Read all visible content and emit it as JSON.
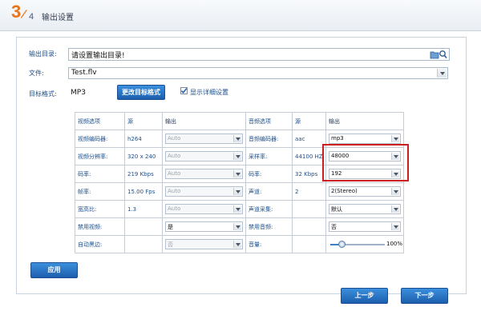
{
  "header": {
    "step_current": "3",
    "step_total": "4",
    "title": "输出设置"
  },
  "form": {
    "output_dir_label": "输出目录:",
    "output_dir_value": "请设置输出目录!",
    "file_label": "文件:",
    "file_value": "Test.flv",
    "target_format_label": "目标格式:",
    "target_format_value": "MP3",
    "change_format_button": "更改目标格式",
    "show_details_label": "显示详细设置",
    "show_details_checked": true
  },
  "table": {
    "headers": [
      "视频选项",
      "源",
      "输出",
      "音频选项",
      "源",
      "输出"
    ],
    "rows": [
      {
        "vlabel": "视频编码器:",
        "vsrc": "h264",
        "vout": "Auto",
        "alabel": "音频编码器:",
        "asrc": "aac",
        "aout": "mp3"
      },
      {
        "vlabel": "视频分辨率:",
        "vsrc": "320 x 240",
        "vout": "Auto",
        "alabel": "采样率:",
        "asrc": "44100 HZ",
        "aout": "48000"
      },
      {
        "vlabel": "码率:",
        "vsrc": "219 Kbps",
        "vout": "Auto",
        "alabel": "码率:",
        "asrc": "32 Kbps",
        "aout": "192"
      },
      {
        "vlabel": "帧率:",
        "vsrc": "15.00 Fps",
        "vout": "Auto",
        "alabel": "声道:",
        "asrc": "2",
        "aout": "2(Stereo)"
      },
      {
        "vlabel": "宽高比:",
        "vsrc": "1.3",
        "vout": "Auto",
        "alabel": "声道采集:",
        "asrc": "",
        "aout": "默认"
      },
      {
        "vlabel": "禁用视频:",
        "vsrc": "",
        "vout": "是",
        "alabel": "禁用音频:",
        "asrc": "",
        "aout": "否"
      },
      {
        "vlabel": "自动黑边:",
        "vsrc": "",
        "vout": "否",
        "alabel": "音量:",
        "asrc": "",
        "aout": "100%"
      }
    ]
  },
  "volume": {
    "percent": 100,
    "label": "100%"
  },
  "buttons": {
    "apply": "应用",
    "prev": "上一步",
    "next": "下一步"
  },
  "colors": {
    "accent": "#e8741b",
    "button": "#2a76c6",
    "highlight": "#cc1f1f"
  }
}
